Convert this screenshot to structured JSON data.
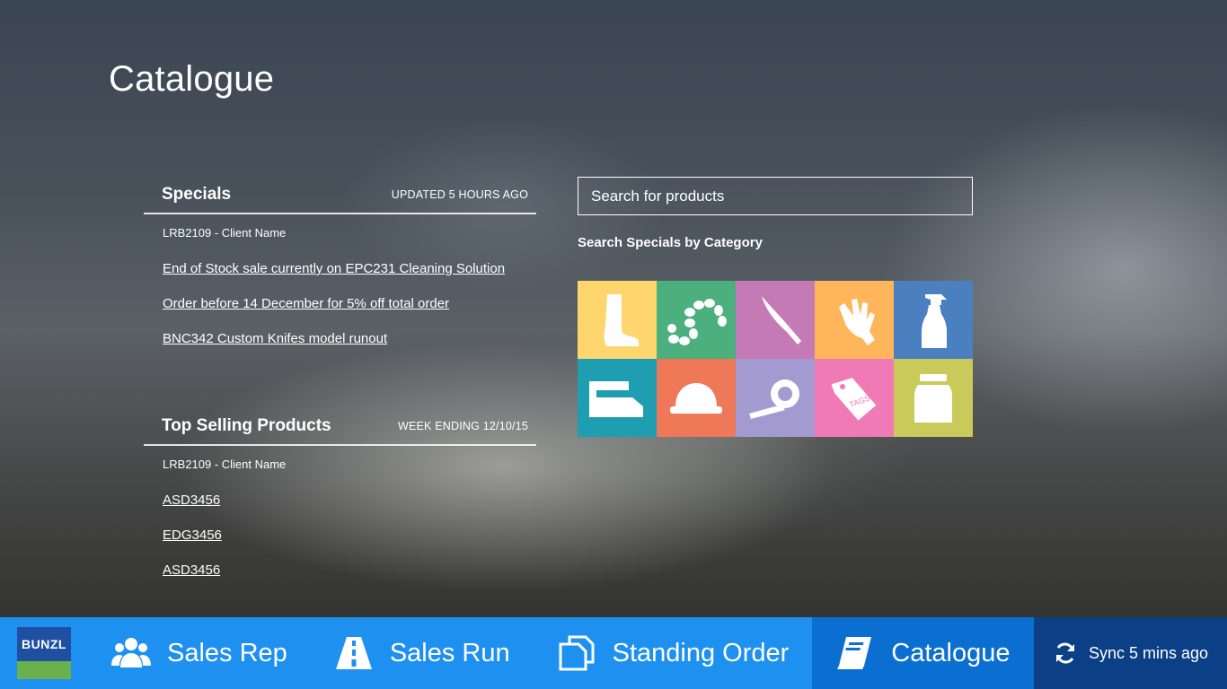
{
  "page": {
    "title": "Catalogue"
  },
  "specials": {
    "title": "Specials",
    "meta": "UPDATED 5 HOURS AGO",
    "client": "LRB2109 - Client Name",
    "links": [
      "End of Stock sale currently on EPC231 Cleaning Solution",
      "Order before 14 December for 5% off total order",
      "BNC342 Custom Knifes model runout"
    ]
  },
  "top_selling": {
    "title": "Top Selling Products",
    "meta": "WEEK ENDING 12/10/15",
    "client": "LRB2109 - Client Name",
    "links": [
      "ASD3456",
      "EDG3456",
      "ASD3456"
    ]
  },
  "search": {
    "placeholder": "Search for products"
  },
  "categories": {
    "heading": "Search Specials by Category",
    "tiles": [
      {
        "icon": "boot-icon",
        "color": "#ffd66e"
      },
      {
        "icon": "sausage-icon",
        "color": "#4caf7e"
      },
      {
        "icon": "knife-icon",
        "color": "#c47ab5"
      },
      {
        "icon": "glove-icon",
        "color": "#ffb55a"
      },
      {
        "icon": "spray-bottle-icon",
        "color": "#4a7fc0"
      },
      {
        "icon": "dispenser-icon",
        "color": "#1f9db1"
      },
      {
        "icon": "hard-hat-icon",
        "color": "#ef7859"
      },
      {
        "icon": "tape-icon",
        "color": "#a39ad0"
      },
      {
        "icon": "tag-icon",
        "color": "#f07ab5",
        "label": "TAGS"
      },
      {
        "icon": "jar-icon",
        "color": "#c9ca5a"
      }
    ]
  },
  "nav": {
    "logo": "BUNZL",
    "items": [
      {
        "label": "Sales Rep",
        "icon": "people-icon"
      },
      {
        "label": "Sales Run",
        "icon": "road-icon"
      },
      {
        "label": "Standing Order",
        "icon": "copy-icon"
      },
      {
        "label": "Catalogue",
        "icon": "book-icon"
      }
    ],
    "sync": {
      "label": "Sync 5 mins ago",
      "icon": "sync-icon"
    }
  },
  "colors": {
    "nav_bar": "#1e90f0",
    "nav_active": "#0a6fd1",
    "sync_bg": "#0b3f86"
  }
}
